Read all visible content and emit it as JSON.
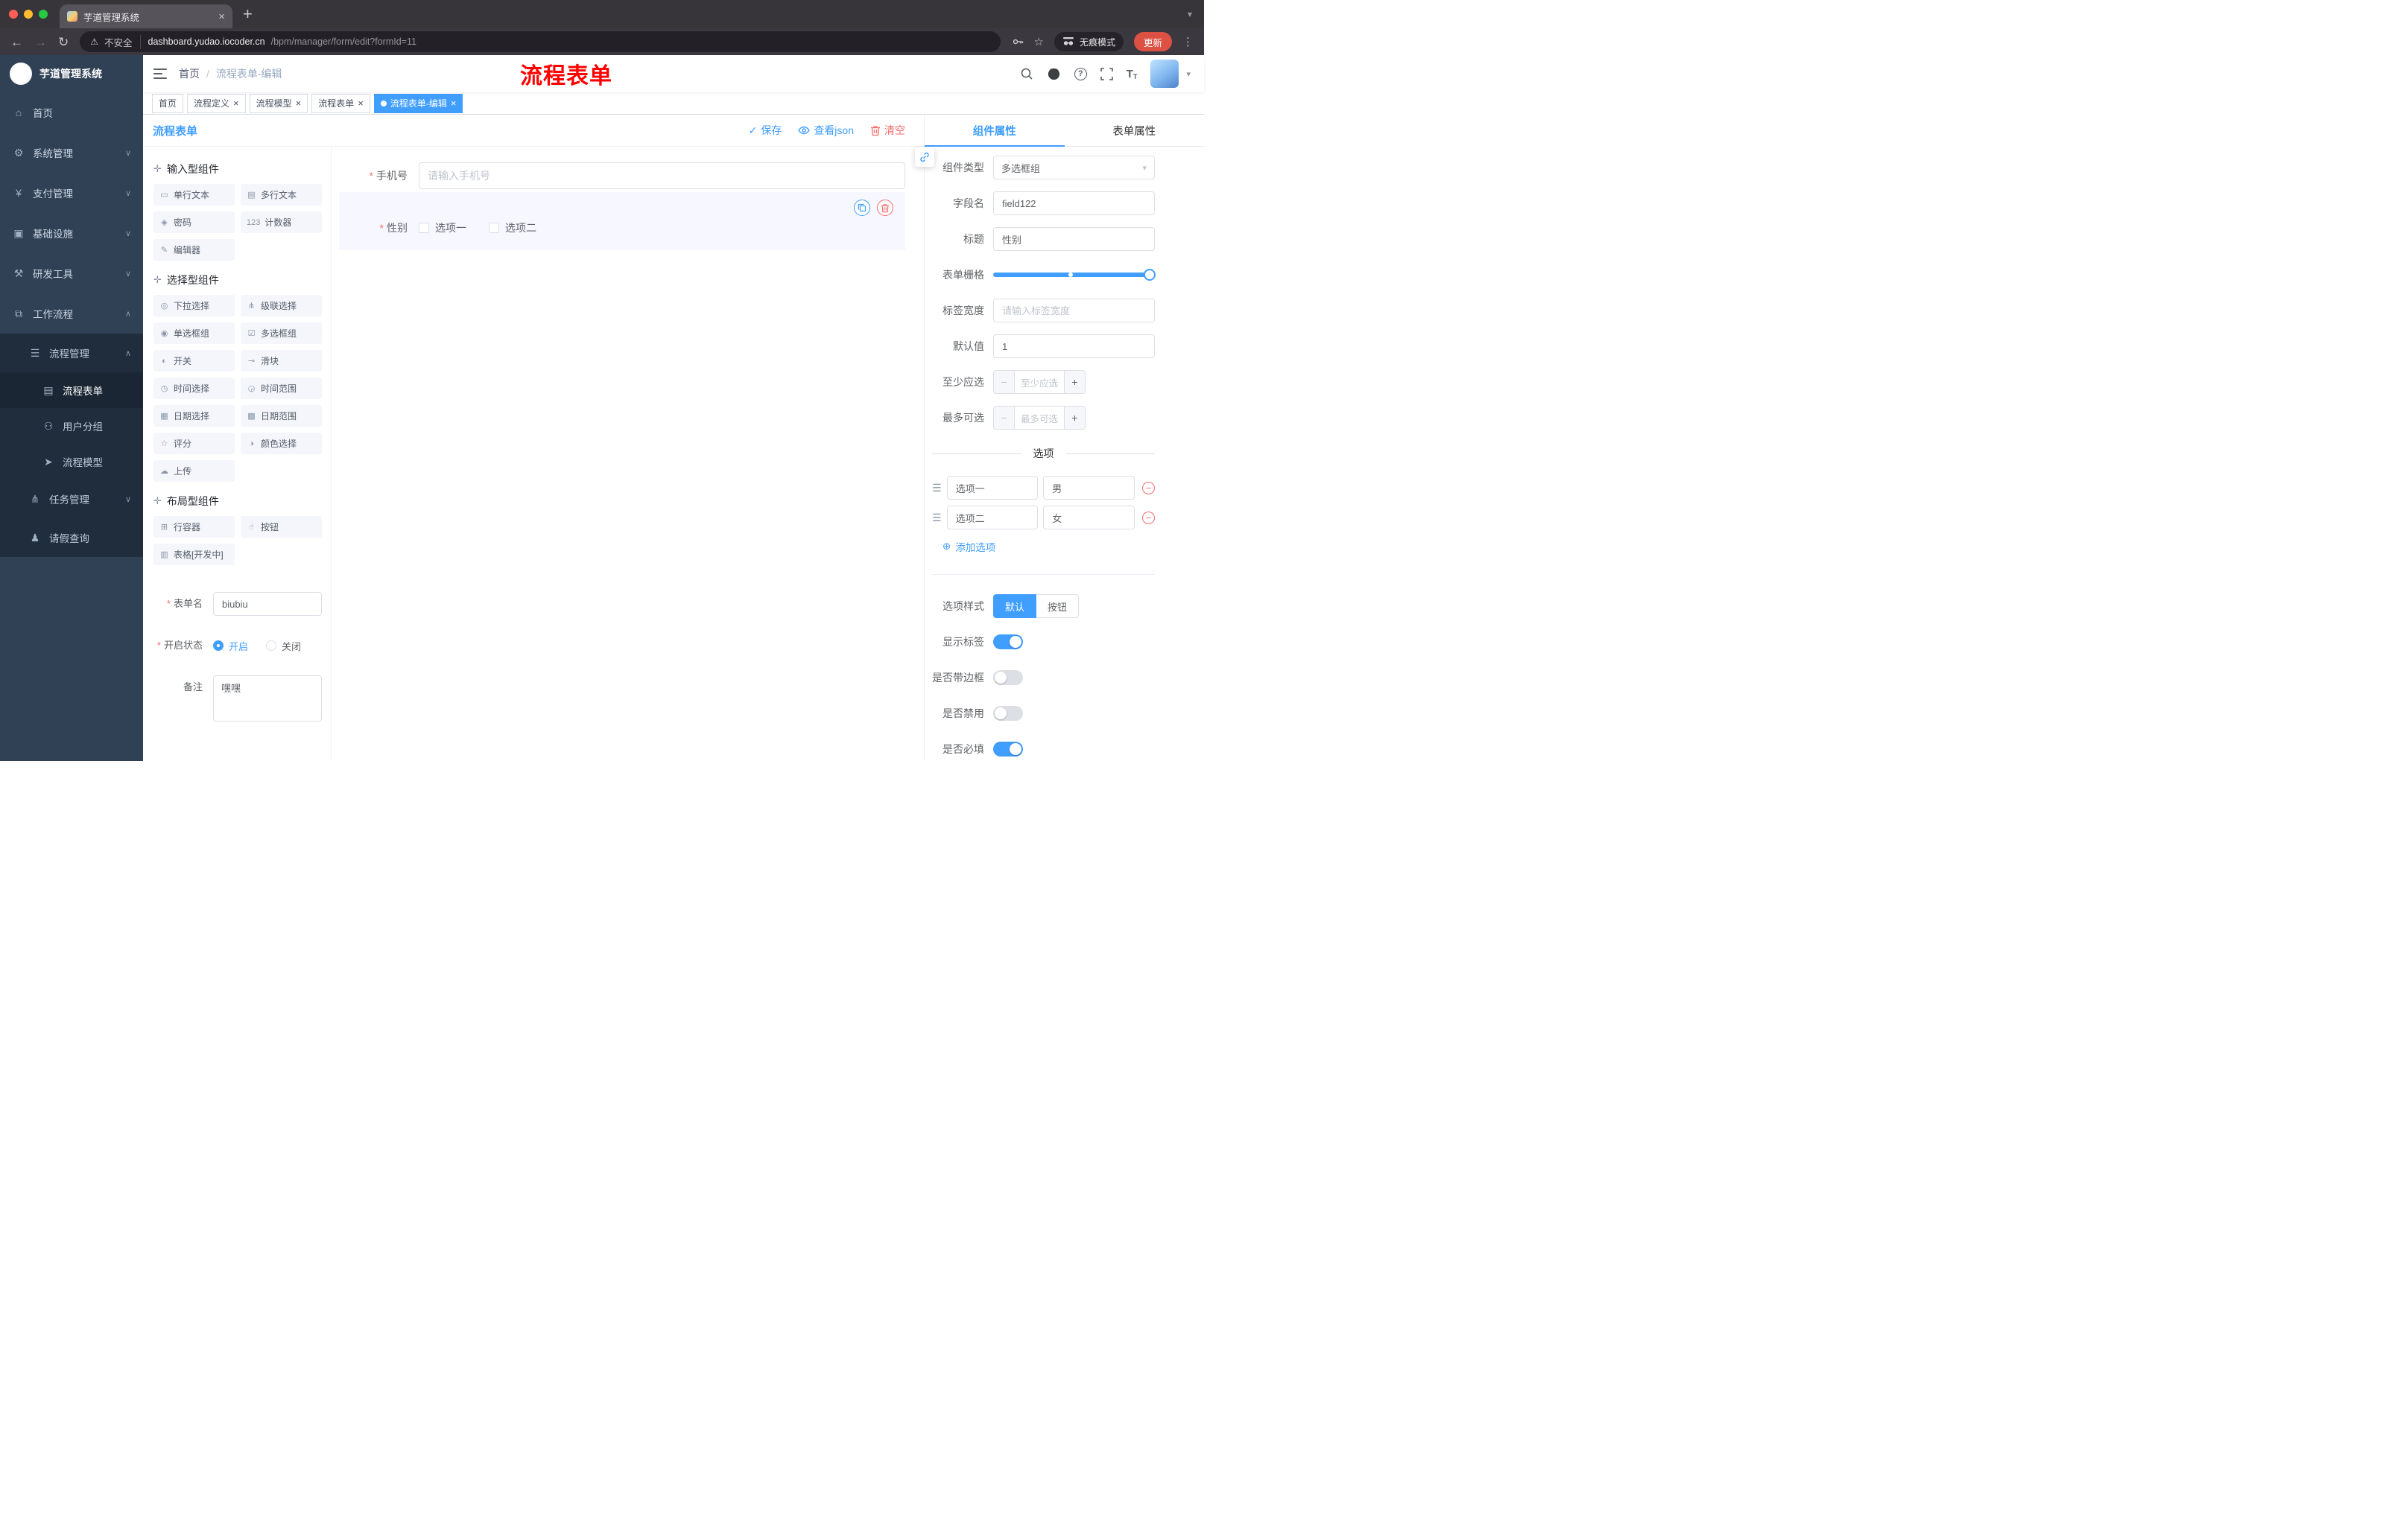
{
  "browser": {
    "tab_title": "芋道管理系统",
    "not_secure": "不安全",
    "url_host": "dashboard.yudao.iocoder.cn",
    "url_path": "/bpm/manager/form/edit?formId=11",
    "incognito": "无痕模式",
    "update": "更新"
  },
  "sidebar": {
    "logo_title": "芋道管理系统",
    "menu": [
      {
        "label": "首页"
      },
      {
        "label": "系统管理"
      },
      {
        "label": "支付管理"
      },
      {
        "label": "基础设施"
      },
      {
        "label": "研发工具"
      },
      {
        "label": "工作流程"
      }
    ],
    "submenu": {
      "group_label": "流程管理",
      "children": [
        {
          "label": "流程表单",
          "active": true
        },
        {
          "label": "用户分组",
          "active": false
        },
        {
          "label": "流程模型",
          "active": false
        }
      ],
      "task_label": "任务管理",
      "leave_label": "请假查询"
    }
  },
  "navbar": {
    "breadcrumb_home": "首页",
    "breadcrumb_sep": "/",
    "breadcrumb_current": "流程表单-编辑",
    "overlay_title": "流程表单"
  },
  "tags": [
    {
      "label": "首页",
      "closable": false,
      "active": false
    },
    {
      "label": "流程定义",
      "closable": true,
      "active": false
    },
    {
      "label": "流程模型",
      "closable": true,
      "active": false
    },
    {
      "label": "流程表单",
      "closable": true,
      "active": false
    },
    {
      "label": "流程表单-编辑",
      "closable": true,
      "active": true
    }
  ],
  "designer": {
    "title": "流程表单",
    "toolbar": {
      "save": "保存",
      "view_json": "查看json",
      "clear": "清空"
    },
    "groups": [
      {
        "icon": "drag",
        "title": "输入型组件",
        "items": [
          {
            "icon": "input",
            "label": "单行文本"
          },
          {
            "icon": "textarea",
            "label": "多行文本"
          },
          {
            "icon": "lock",
            "label": "密码"
          },
          {
            "icon": "counter",
            "label": "计数器"
          },
          {
            "icon": "editor",
            "label": "编辑器"
          }
        ]
      },
      {
        "icon": "drag",
        "title": "选择型组件",
        "items": [
          {
            "icon": "select",
            "label": "下拉选择"
          },
          {
            "icon": "cascader",
            "label": "级联选择"
          },
          {
            "icon": "radio",
            "label": "单选框组"
          },
          {
            "icon": "checkbox",
            "label": "多选框组"
          },
          {
            "icon": "switch",
            "label": "开关"
          },
          {
            "icon": "slider",
            "label": "滑块"
          },
          {
            "icon": "time",
            "label": "时间选择"
          },
          {
            "icon": "time-range",
            "label": "时间范围"
          },
          {
            "icon": "date",
            "label": "日期选择"
          },
          {
            "icon": "date-range",
            "label": "日期范围"
          },
          {
            "icon": "rate",
            "label": "评分"
          },
          {
            "icon": "color",
            "label": "颜色选择"
          },
          {
            "icon": "upload",
            "label": "上传"
          }
        ]
      },
      {
        "icon": "drag",
        "title": "布局型组件",
        "items": [
          {
            "icon": "row",
            "label": "行容器"
          },
          {
            "icon": "button",
            "label": "按钮"
          },
          {
            "icon": "table",
            "label": "表格[开发中]"
          }
        ]
      }
    ],
    "form": {
      "name_label": "表单名",
      "name_value": "biubiu",
      "status_label": "开启状态",
      "status_on": "开启",
      "status_off": "关闭",
      "remark_label": "备注",
      "remark_value": "嘿嘿"
    }
  },
  "canvas": {
    "phone_label": "手机号",
    "phone_placeholder": "请输入手机号",
    "gender_label": "性别",
    "gender_options": [
      "选项一",
      "选项二"
    ]
  },
  "props": {
    "tab_component": "组件属性",
    "tab_form": "表单属性",
    "component_type_label": "组件类型",
    "component_type_value": "多选框组",
    "field_label": "字段名",
    "field_value": "field122",
    "title_label": "标题",
    "title_value": "性别",
    "grid_label": "表单栅格",
    "tag_width_label": "标签宽度",
    "tag_width_placeholder": "请输入标签宽度",
    "default_label": "默认值",
    "default_value": "1",
    "min_label": "至少应选",
    "min_placeholder": "至少应选",
    "max_label": "最多可选",
    "max_placeholder": "最多可选",
    "options_title": "选项",
    "options": [
      {
        "label": "选项一",
        "value": "男"
      },
      {
        "label": "选项二",
        "value": "女"
      }
    ],
    "add_option": "添加选项",
    "style_label": "选项样式",
    "style_default": "默认",
    "style_button": "按钮",
    "show_label": "显示标签",
    "border_label": "是否带边框",
    "disabled_label": "是否禁用",
    "required_label": "是否必填"
  },
  "colors": {
    "primary": "#409EFF",
    "danger": "#F56C6C",
    "red_title": "#FF0000",
    "sidebar_bg": "#304156",
    "submenu_bg": "#1F2D3D"
  }
}
